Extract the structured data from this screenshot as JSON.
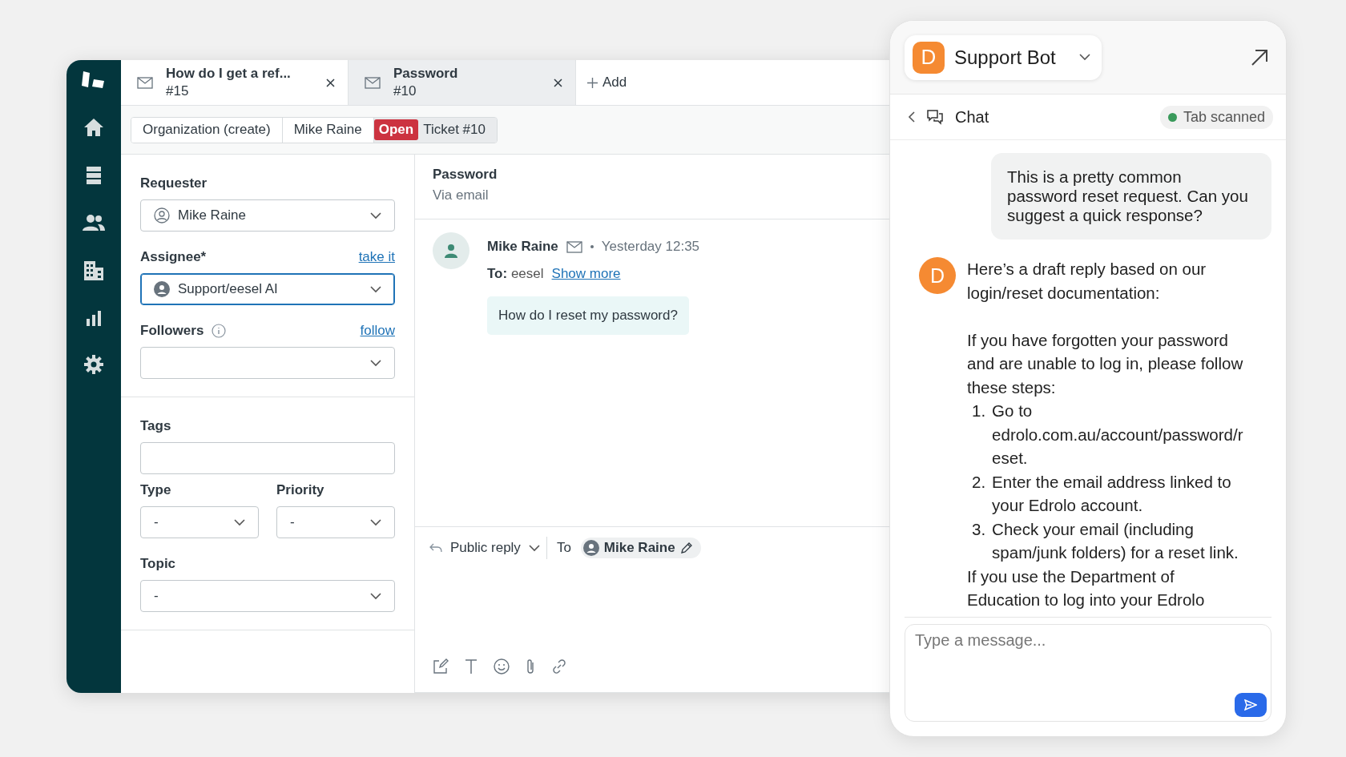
{
  "tabs": [
    {
      "title": "How do I get a ref...",
      "number": "#15",
      "selected": false
    },
    {
      "title": "Password",
      "number": "#10",
      "selected": true
    }
  ],
  "add_tab": "Add",
  "breadcrumbs": [
    {
      "kind": "plain",
      "label": "Organization (create)",
      "selected": false
    },
    {
      "kind": "plain",
      "label": "Mike Raine",
      "selected": false
    },
    {
      "kind": "ticket",
      "status": "Open",
      "label": "Ticket #10",
      "selected": true
    }
  ],
  "ticket_fields": {
    "requester": {
      "label": "Requester",
      "value": "Mike Raine",
      "focused": false
    },
    "assignee": {
      "label": "Assignee*",
      "link": "take it",
      "value": "Support/eesel AI",
      "focused": true
    },
    "followers": {
      "label": "Followers",
      "link": "follow",
      "focused": false
    },
    "tags": {
      "label": "Tags"
    },
    "type": {
      "label": "Type",
      "value": "-"
    },
    "priority": {
      "label": "Priority",
      "value": "-"
    },
    "topic": {
      "label": "Topic",
      "value": "-"
    }
  },
  "conversation": {
    "subject": "Password",
    "channel": "Via email",
    "messages": [
      {
        "author": "Mike Raine",
        "time": "Yesterday 12:35",
        "to_label": "To:",
        "to": "eesel",
        "show_more": "Show more",
        "body": "How do I reset my password?"
      }
    ]
  },
  "reply": {
    "mode": "Public reply",
    "to_label": "To",
    "recipient": "Mike Raine"
  },
  "assistant": {
    "avatar_letter": "D",
    "bot_name": "Support Bot",
    "section": "Chat",
    "status": "Tab scanned",
    "messages": [
      {
        "kind": "user",
        "text": "This is a pretty common password reset request. Can you suggest a quick response?"
      },
      {
        "kind": "bot",
        "avatar_letter": "D",
        "blocks": [
          {
            "kind": "paragraph",
            "text": "Here’s a draft reply based on our login/reset documentation:"
          },
          {
            "kind": "line",
            "text": "If you have forgotten your password and are unable to log in, please follow these steps:"
          },
          {
            "kind": "step",
            "number": "1.",
            "text": "Go to edrolo.com.au/account/password/reset."
          },
          {
            "kind": "step",
            "number": "2.",
            "text": "Enter the email address linked to your Edrolo account."
          },
          {
            "kind": "step",
            "number": "3.",
            "text": "Check your email (including spam/junk folders) for a reset link."
          },
          {
            "kind": "line",
            "text": "If you use the Department of Education to log into your Edrolo"
          }
        ]
      }
    ],
    "input_placeholder": "Type a message..."
  }
}
